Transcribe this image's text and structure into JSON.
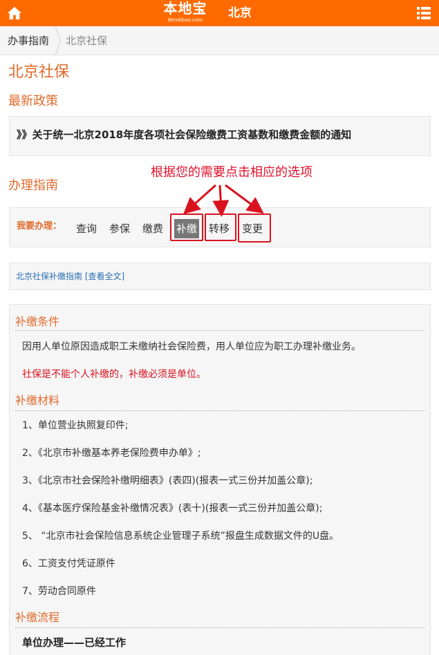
{
  "header": {
    "logo_text": "本地宝",
    "logo_sub": "Bendibao.com",
    "city": "北京"
  },
  "breadcrumb": [
    "办事指南",
    "北京社保"
  ],
  "page_title": "北京社保",
  "sections": {
    "policy": "最新政策",
    "guide": "办理指南"
  },
  "policy_link": "》》关于统一北京2018年度各项社会保险缴费工资基数和缴费金额的通知",
  "annotation": "根据您的需要点击相应的选项",
  "actions": {
    "label": "我要办理：",
    "items": [
      "查询",
      "参保",
      "缴费",
      "补缴",
      "转移",
      "变更"
    ],
    "active": "补缴"
  },
  "guide_link": {
    "text": "北京社保补缴指南",
    "more": "[查看全文]"
  },
  "content": {
    "conditions_heading": "补缴条件",
    "conditions_text": "因用人单位原因造成职工未缴纳社会保险费，用人单位应为职工办理补缴业务。",
    "conditions_note": "社保是不能个人补缴的，补缴必须是单位。",
    "materials_heading": "补缴材料",
    "materials": [
      "1、单位营业执照复印件;",
      "2、《北京市补缴基本养老保险费申办单》;",
      "3、《北京市社会保险补缴明细表》(表四)(报表一式三份并加盖公章);",
      "4、《基本医疗保险基金补缴情况表》(表十)(报表一式三份并加盖公章);",
      "5、 “北京市社会保险信息系统企业管理子系统”报盘生成数据文件的U盘。",
      "6、工资支付凭证原件",
      "7、劳动合同原件"
    ],
    "process_heading": "补缴流程",
    "process_text": "单位办理——已经工作"
  },
  "colors": {
    "brand": "#ff6a00",
    "heading": "#e06a2c",
    "highlight": "#d9121f",
    "link": "#2a6fb3"
  }
}
